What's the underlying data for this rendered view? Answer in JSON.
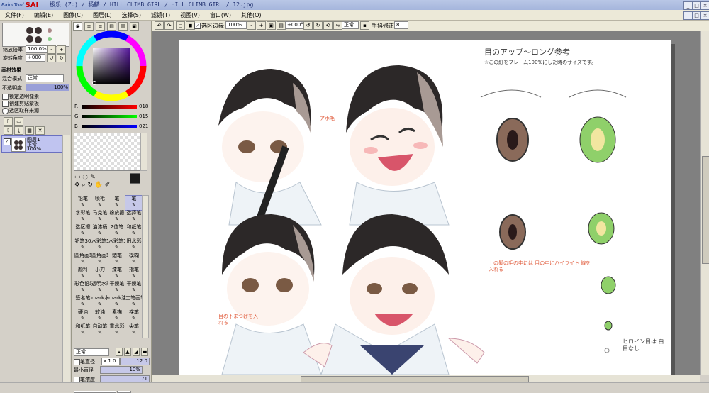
{
  "app": {
    "logo_prefix": "PaintTool",
    "logo_name": "SAI",
    "window_title": "极乐 (Z:) / 杨麟 / HILL CLIMB GIRL / HILL CLIMB GIRL / 12.jpg"
  },
  "menu": [
    "文件(F)",
    "编辑(E)",
    "图像(C)",
    "图层(L)",
    "选择(S)",
    "滤镜(T)",
    "视图(V)",
    "窗口(W)",
    "其他(O)"
  ],
  "navigator": {
    "zoom_label": "缩放倍率",
    "zoom_value": "100.0%",
    "angle_label": "旋转角度",
    "angle_value": "+000"
  },
  "layer_effects": {
    "header": "画材效果",
    "blend_label": "混合模式",
    "blend_value": "正常",
    "opacity_label": "不透明度",
    "opacity_value": "100%",
    "options": [
      "锁定透明像素",
      "创建剪贴蒙板",
      "选区取样来源"
    ]
  },
  "layers": [
    {
      "name": "图层1",
      "mode": "正常",
      "opacity": "100%"
    }
  ],
  "color": {
    "current": "#1a1a1a",
    "r_label": "R",
    "r_value": "018",
    "g_label": "G",
    "g_value": "015",
    "b_label": "B",
    "b_value": "021"
  },
  "tools": [
    [
      "铅笔",
      "喷枪",
      "笔",
      "笔"
    ],
    [
      "水彩笔",
      "马克笔",
      "橡皮擦",
      "选择笔"
    ],
    [
      "选区擦",
      "油漆桶",
      "2值笔",
      "和纸笔"
    ],
    [
      "铅笔30",
      "水彩笔50",
      "水彩笔100",
      "旧水彩"
    ],
    [
      "圆角画笔",
      "圆角画笔",
      "蜡笔",
      "模糊"
    ],
    [
      "颜料",
      "小刀",
      "漆笔",
      "指笔"
    ],
    [
      "彩色铅笔",
      "透明水彩",
      "干燥笔",
      "干燥笔"
    ],
    [
      "签名笔",
      "mark水性",
      "mark油性",
      "工笔画笔"
    ],
    [
      "硬油",
      "软油",
      "素描",
      "疾笔"
    ],
    [
      "和纸笔",
      "自动笔",
      "重水彩",
      "尖笔"
    ]
  ],
  "brush": {
    "mode": "正常",
    "size_label": "笔直径",
    "size_mult": "x 1.0",
    "size_value": "12.0",
    "min_label": "最小直径",
    "min_value": "10%",
    "density_label": "笔浓度",
    "density_value": "71",
    "shape_label": "【常规的圆形】",
    "shape_value": "50"
  },
  "canvas_toolbar": {
    "select_edge_label": "选区边缘",
    "zoom": "100%",
    "angle": "+000°",
    "mode": "正常",
    "stabilizer_label": "手抖修正",
    "stabilizer_value": "8"
  },
  "artwork": {
    "title": "目のアップ〜ロング参考",
    "subtitle": "☆この紙をフレーム100%にした時のサイズです。",
    "note1": "アホ毛",
    "note2": "上の髪の毛の中には 目の中にハイライト 線を入れる",
    "note3": "目の下まつげを入れる",
    "note4": "ヒロイン目は 白目なし"
  }
}
